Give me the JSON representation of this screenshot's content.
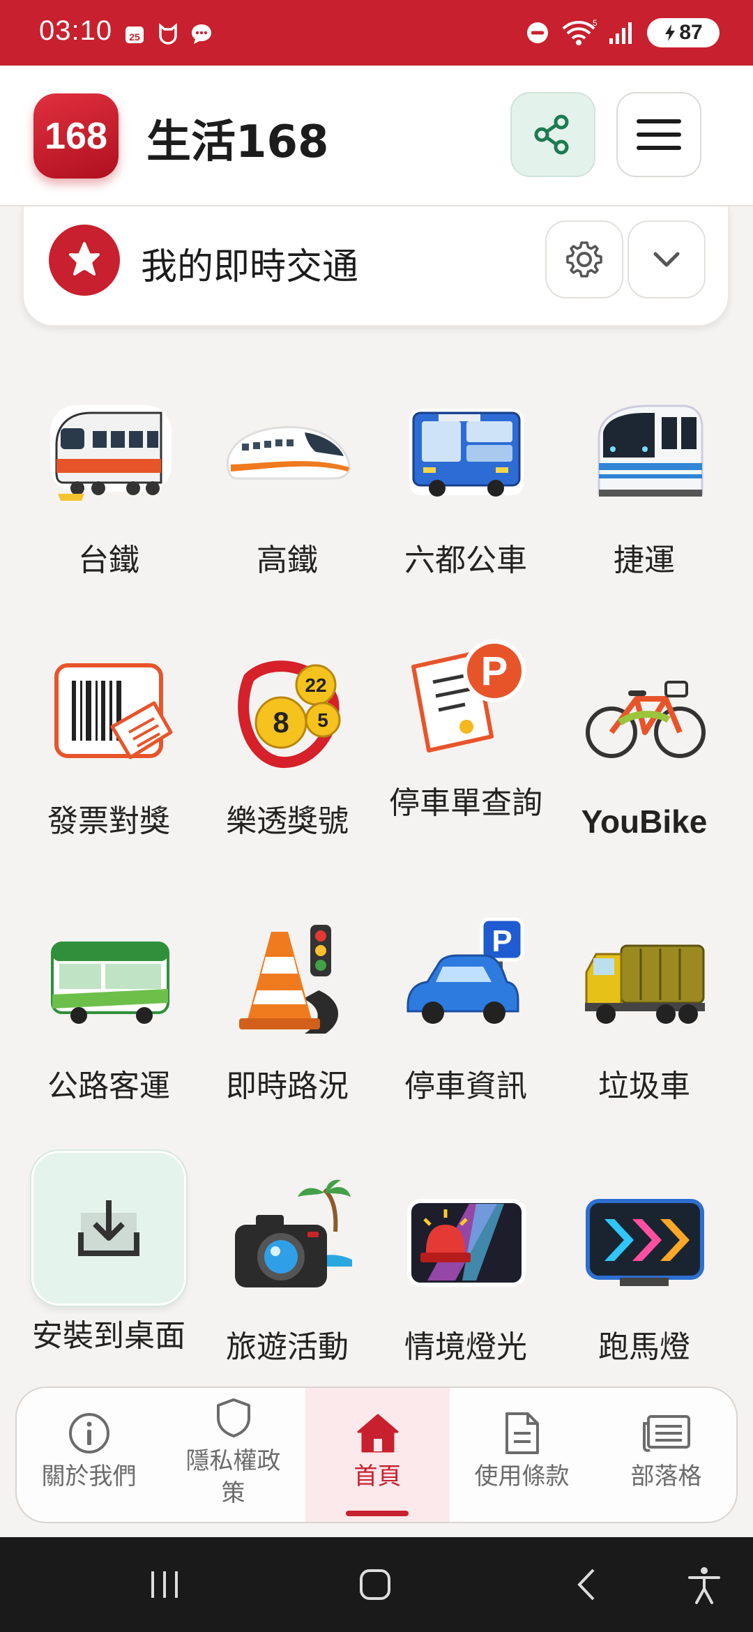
{
  "status_bar": {
    "time": "03:10",
    "calendar_day": "25",
    "battery": "87",
    "wifi_label": "5",
    "colors": {
      "background": "#c8202e"
    }
  },
  "header": {
    "logo_text": "168",
    "title": "生活168"
  },
  "traffic_card": {
    "title": "我的即時交通"
  },
  "grid": {
    "items": [
      {
        "label": "台鐵",
        "icon": "train-icon"
      },
      {
        "label": "高鐵",
        "icon": "high-speed-rail-icon"
      },
      {
        "label": "六都公車",
        "icon": "city-bus-icon"
      },
      {
        "label": "捷運",
        "icon": "metro-icon"
      },
      {
        "label": "發票對獎",
        "icon": "receipt-barcode-icon"
      },
      {
        "label": "樂透獎號",
        "icon": "lottery-balls-icon",
        "balls": [
          "8",
          "22",
          "5"
        ]
      },
      {
        "label": "停車單查詢",
        "icon": "parking-ticket-icon",
        "badge": "P"
      },
      {
        "label": "YouBike",
        "icon": "bicycle-icon"
      },
      {
        "label": "公路客運",
        "icon": "coach-bus-icon"
      },
      {
        "label": "即時路況",
        "icon": "traffic-cone-icon"
      },
      {
        "label": "停車資訊",
        "icon": "car-parking-icon",
        "badge": "P"
      },
      {
        "label": "垃圾車",
        "icon": "garbage-truck-icon"
      },
      {
        "label": "安裝到桌面",
        "icon": "download-icon"
      },
      {
        "label": "旅遊活動",
        "icon": "camera-palm-icon"
      },
      {
        "label": "情境燈光",
        "icon": "siren-light-icon"
      },
      {
        "label": "跑馬燈",
        "icon": "marquee-arrows-icon"
      }
    ]
  },
  "bottom_nav": {
    "items": [
      {
        "label": "關於我們",
        "icon": "info-icon"
      },
      {
        "label": "隱私權政策",
        "icon": "shield-icon"
      },
      {
        "label": "首頁",
        "icon": "home-icon",
        "active": true
      },
      {
        "label": "使用條款",
        "icon": "document-icon"
      },
      {
        "label": "部落格",
        "icon": "blog-list-icon"
      }
    ],
    "colors": {
      "active": "#c8202e"
    }
  }
}
